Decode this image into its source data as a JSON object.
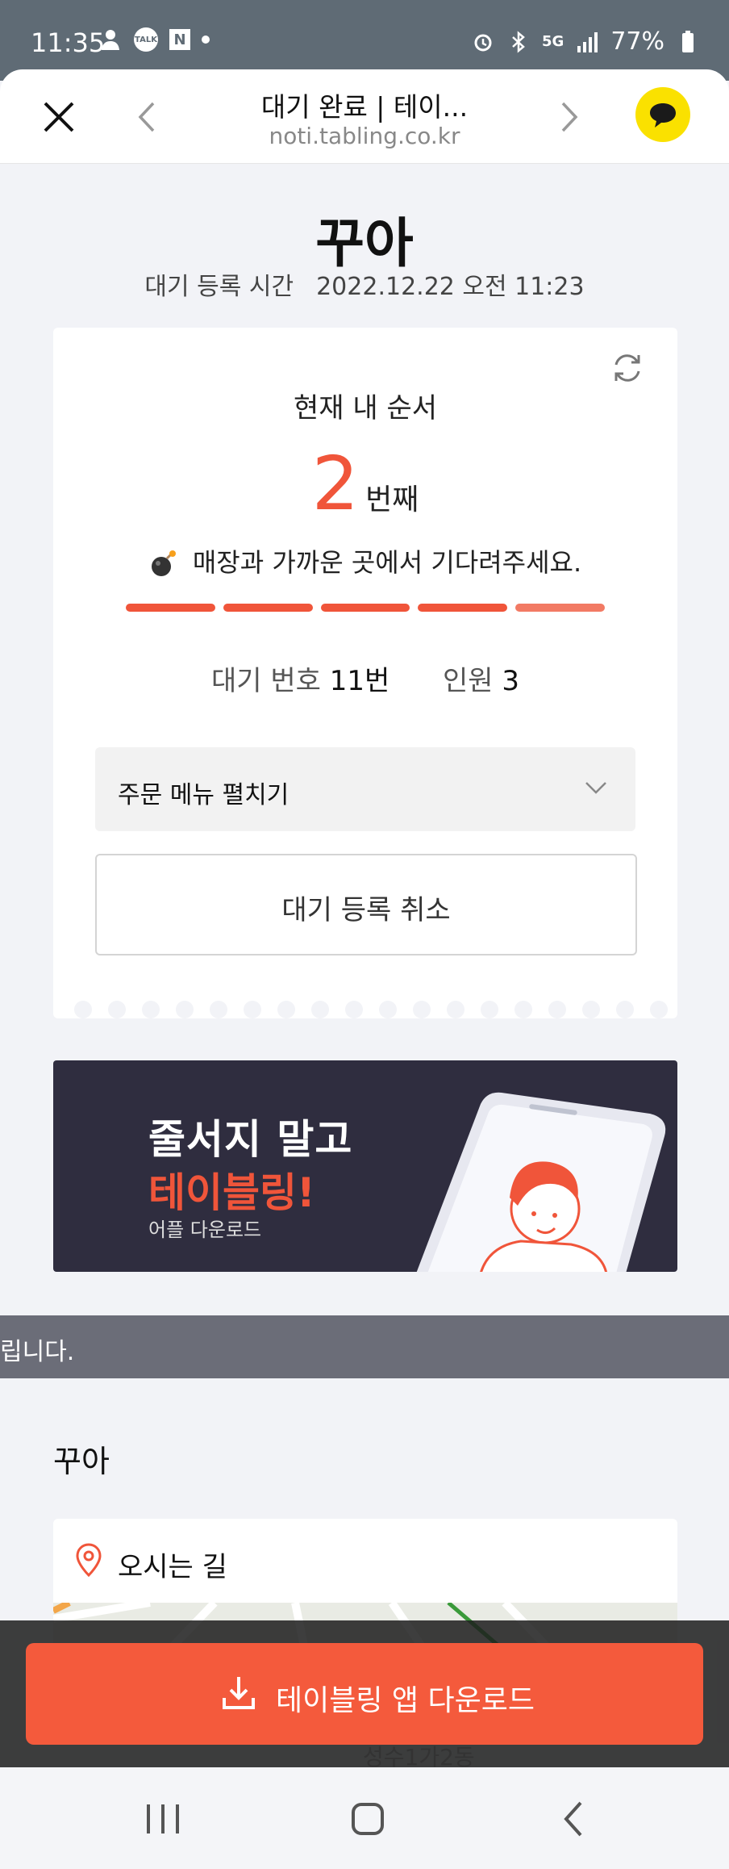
{
  "status_bar": {
    "time": "11:35",
    "talk_icon_text": "TALK",
    "n_icon_text": "N",
    "network": "5G",
    "battery": "77%"
  },
  "browser": {
    "title": "대기 완료 | 테이...",
    "url": "noti.tabling.co.kr"
  },
  "store": {
    "name": "꾸아",
    "reg_time_label": "대기 등록 시간",
    "reg_time_value": "2022.12.22 오전 11:23"
  },
  "queue_card": {
    "my_order_label": "현재 내 순서",
    "order_number": "2",
    "order_unit": "번째",
    "wait_message": "매장과 가까운 곳에서 기다려주세요.",
    "progress_segments": 5,
    "wait_no_label": "대기 번호",
    "wait_no_value": "11번",
    "people_label": "인원",
    "people_value": "3",
    "menu_toggle_label": "주문 메뉴 펼치기",
    "cancel_label": "대기 등록 취소"
  },
  "banner": {
    "line1": "줄서지 말고",
    "line2": "테이블링!",
    "line3": "어플 다운로드"
  },
  "notice": {
    "text": "립니다."
  },
  "location": {
    "section_title": "꾸아",
    "directions_label": "오시는 길",
    "map_text": "성수1가2동"
  },
  "download": {
    "label": "테이블링 앱 다운로드"
  },
  "colors": {
    "accent": "#f0553a",
    "status_bar": "#5f6b75",
    "kakao": "#fae100",
    "banner_bg": "#2f2d3f"
  }
}
